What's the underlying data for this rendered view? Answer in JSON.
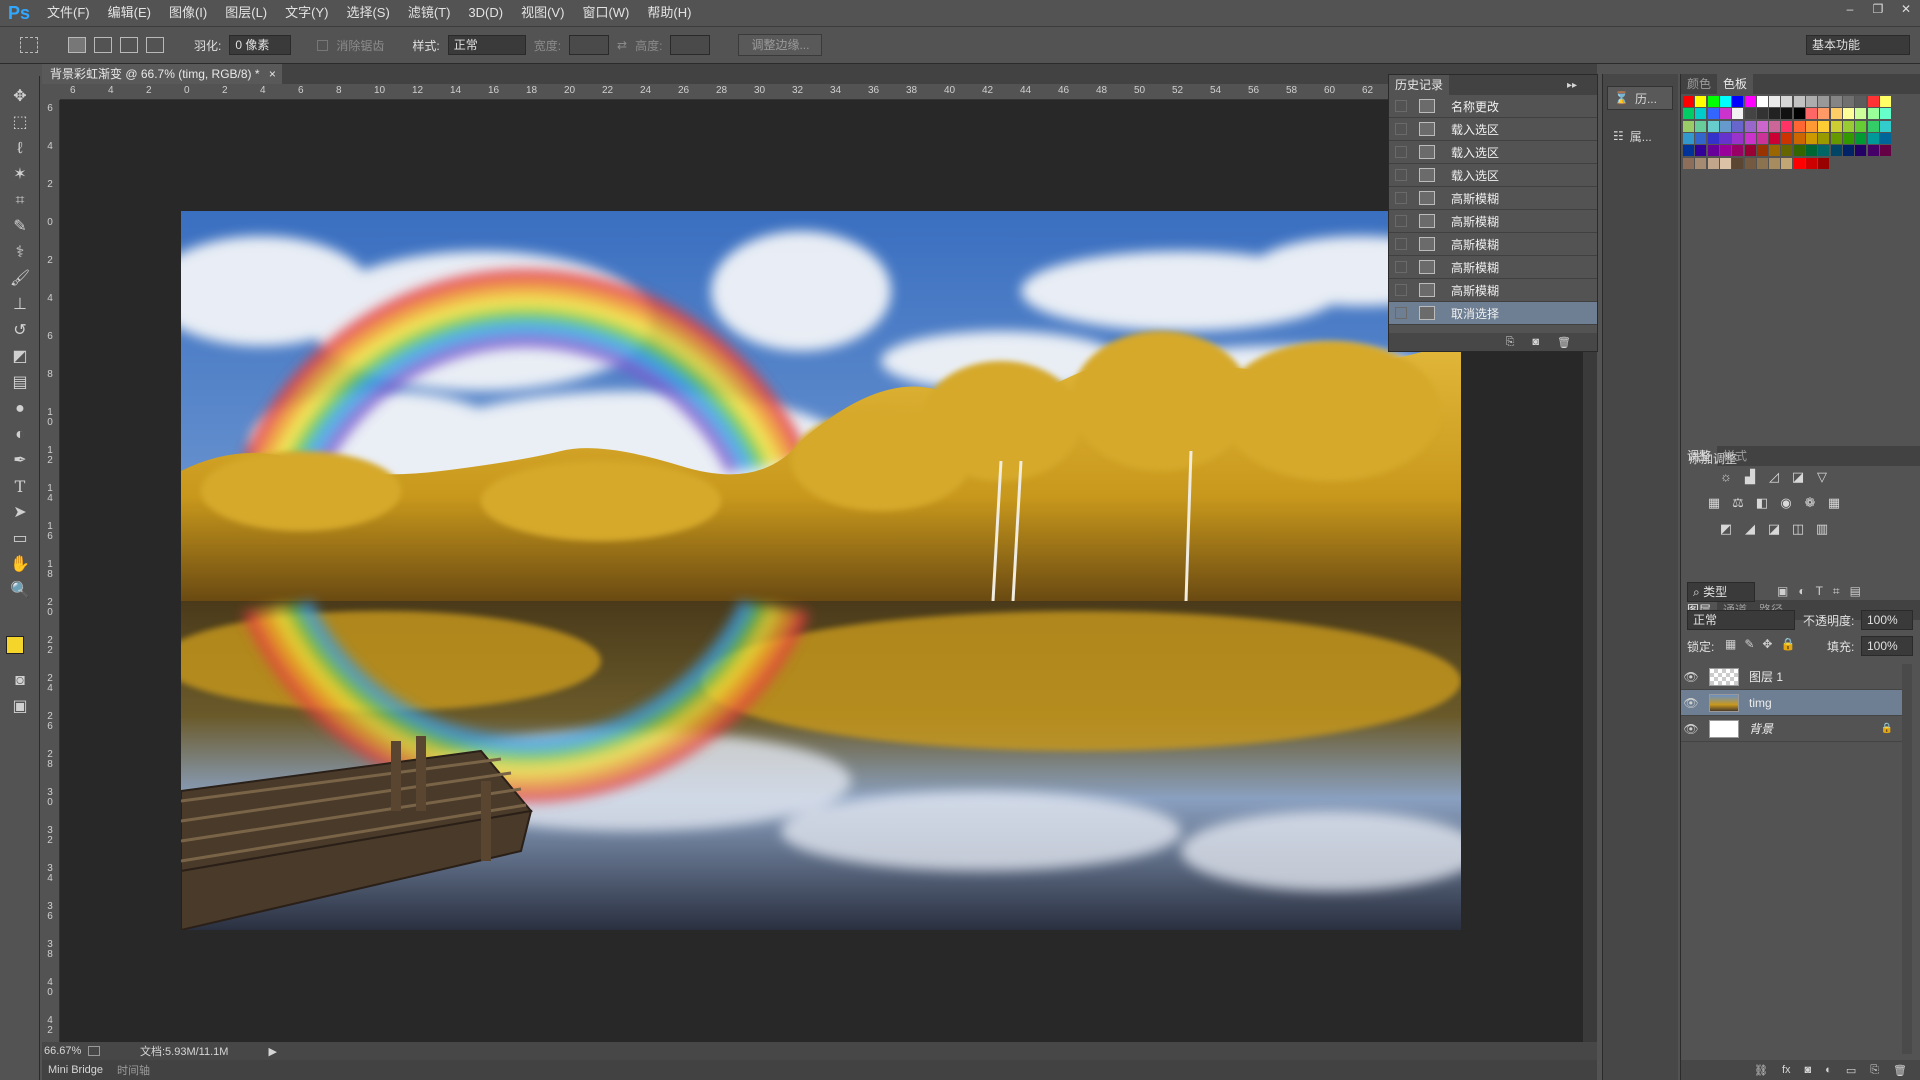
{
  "app": {
    "logo": "Ps"
  },
  "menu": [
    "文件(F)",
    "编辑(E)",
    "图像(I)",
    "图层(L)",
    "文字(Y)",
    "选择(S)",
    "滤镜(T)",
    "3D(D)",
    "视图(V)",
    "窗口(W)",
    "帮助(H)"
  ],
  "window_controls": {
    "minimize": "–",
    "restore": "❐",
    "close": "✕"
  },
  "options": {
    "feather_label": "羽化:",
    "feather_value": "0 像素",
    "antialias_label": "消除锯齿",
    "style_label": "样式:",
    "style_value": "正常",
    "width_label": "宽度:",
    "height_label": "高度:",
    "refine_edge": "调整边缘...",
    "workspace": "基本功能"
  },
  "document": {
    "tab_title": "背景彩虹渐变 @ 66.7% (timg, RGB/8) *",
    "zoom": "66.67%",
    "doc_size": "文档:5.93M/11.1M"
  },
  "ruler": {
    "h_ticks": [
      "6",
      "4",
      "2",
      "0",
      "2",
      "4",
      "6",
      "8",
      "10",
      "12",
      "14",
      "16",
      "18",
      "20",
      "22",
      "24",
      "26",
      "28",
      "30",
      "32",
      "34",
      "36",
      "38",
      "40",
      "42",
      "44",
      "46",
      "48",
      "50",
      "52",
      "54",
      "56",
      "58",
      "60",
      "62"
    ],
    "v_ticks": [
      "6",
      "4",
      "2",
      "0",
      "2",
      "4",
      "6",
      "8",
      "1 0",
      "1 2",
      "1 4",
      "1 6",
      "1 8",
      "2 0",
      "2 2",
      "2 4",
      "2 6",
      "2 8",
      "3 0",
      "3 2",
      "3 4",
      "3 6",
      "3 8",
      "4 0",
      "4 2"
    ]
  },
  "bottom_tabs": [
    "Mini Bridge",
    "时间轴"
  ],
  "history": {
    "tabs": [
      "历史记录"
    ],
    "items": [
      {
        "label": "名称更改",
        "selected": false
      },
      {
        "label": "载入选区",
        "selected": false
      },
      {
        "label": "载入选区",
        "selected": false
      },
      {
        "label": "载入选区",
        "selected": false
      },
      {
        "label": "高斯模糊",
        "selected": false
      },
      {
        "label": "高斯模糊",
        "selected": false
      },
      {
        "label": "高斯模糊",
        "selected": false
      },
      {
        "label": "高斯模糊",
        "selected": false
      },
      {
        "label": "高斯模糊",
        "selected": false
      },
      {
        "label": "取消选择",
        "selected": true
      }
    ]
  },
  "iconstrip": {
    "history": "历...",
    "properties": "属..."
  },
  "color_panel": {
    "tabs": [
      "颜色",
      "色板"
    ],
    "active": "色板"
  },
  "adjust_panel": {
    "tabs": [
      "调整",
      "样式"
    ],
    "title": "添加调整"
  },
  "layers_panel": {
    "tabs": [
      "图层",
      "通道",
      "路径"
    ],
    "filter": "类型",
    "blend_mode": "正常",
    "opacity_label": "不透明度:",
    "opacity_value": "100%",
    "lock_label": "锁定:",
    "fill_label": "填充:",
    "fill_value": "100%",
    "layers": [
      {
        "name": "图层 1",
        "selected": false
      },
      {
        "name": "timg",
        "selected": true
      },
      {
        "name": "背景",
        "selected": false
      }
    ]
  },
  "colors": {
    "accent_selection": "#6e7f93",
    "foreground": "#f5d52a",
    "background": "#3a8fdc"
  }
}
